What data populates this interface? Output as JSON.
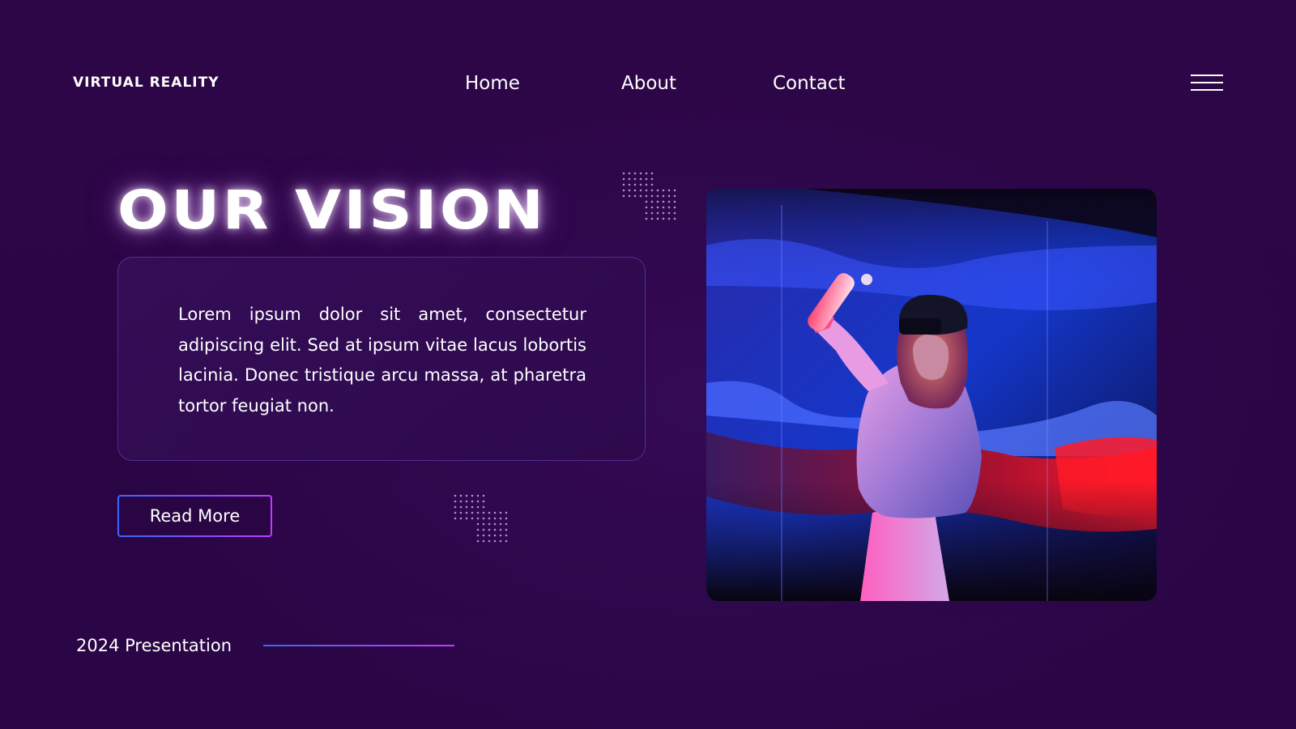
{
  "header": {
    "brand": "VIRTUAL REALITY",
    "nav": [
      {
        "label": "Home"
      },
      {
        "label": "About"
      },
      {
        "label": "Contact"
      }
    ],
    "menu_icon": "hamburger-menu-icon"
  },
  "hero": {
    "title": "OUR VISION",
    "body": "Lorem ipsum dolor sit amet, consectetur adipiscing elit. Sed at ipsum vitae lacus lobortis lacinia. Donec tristique arcu massa, at pharetra tortor feugiat non.",
    "cta_label": "Read More",
    "image_subject": "woman-wearing-vr-headset-holding-light-wand"
  },
  "footer": {
    "caption": "2024 Presentation"
  },
  "colors": {
    "background": "#2a0544",
    "accent_blue": "#3a66ff",
    "accent_purple": "#c23bff",
    "text": "#ffffff"
  }
}
